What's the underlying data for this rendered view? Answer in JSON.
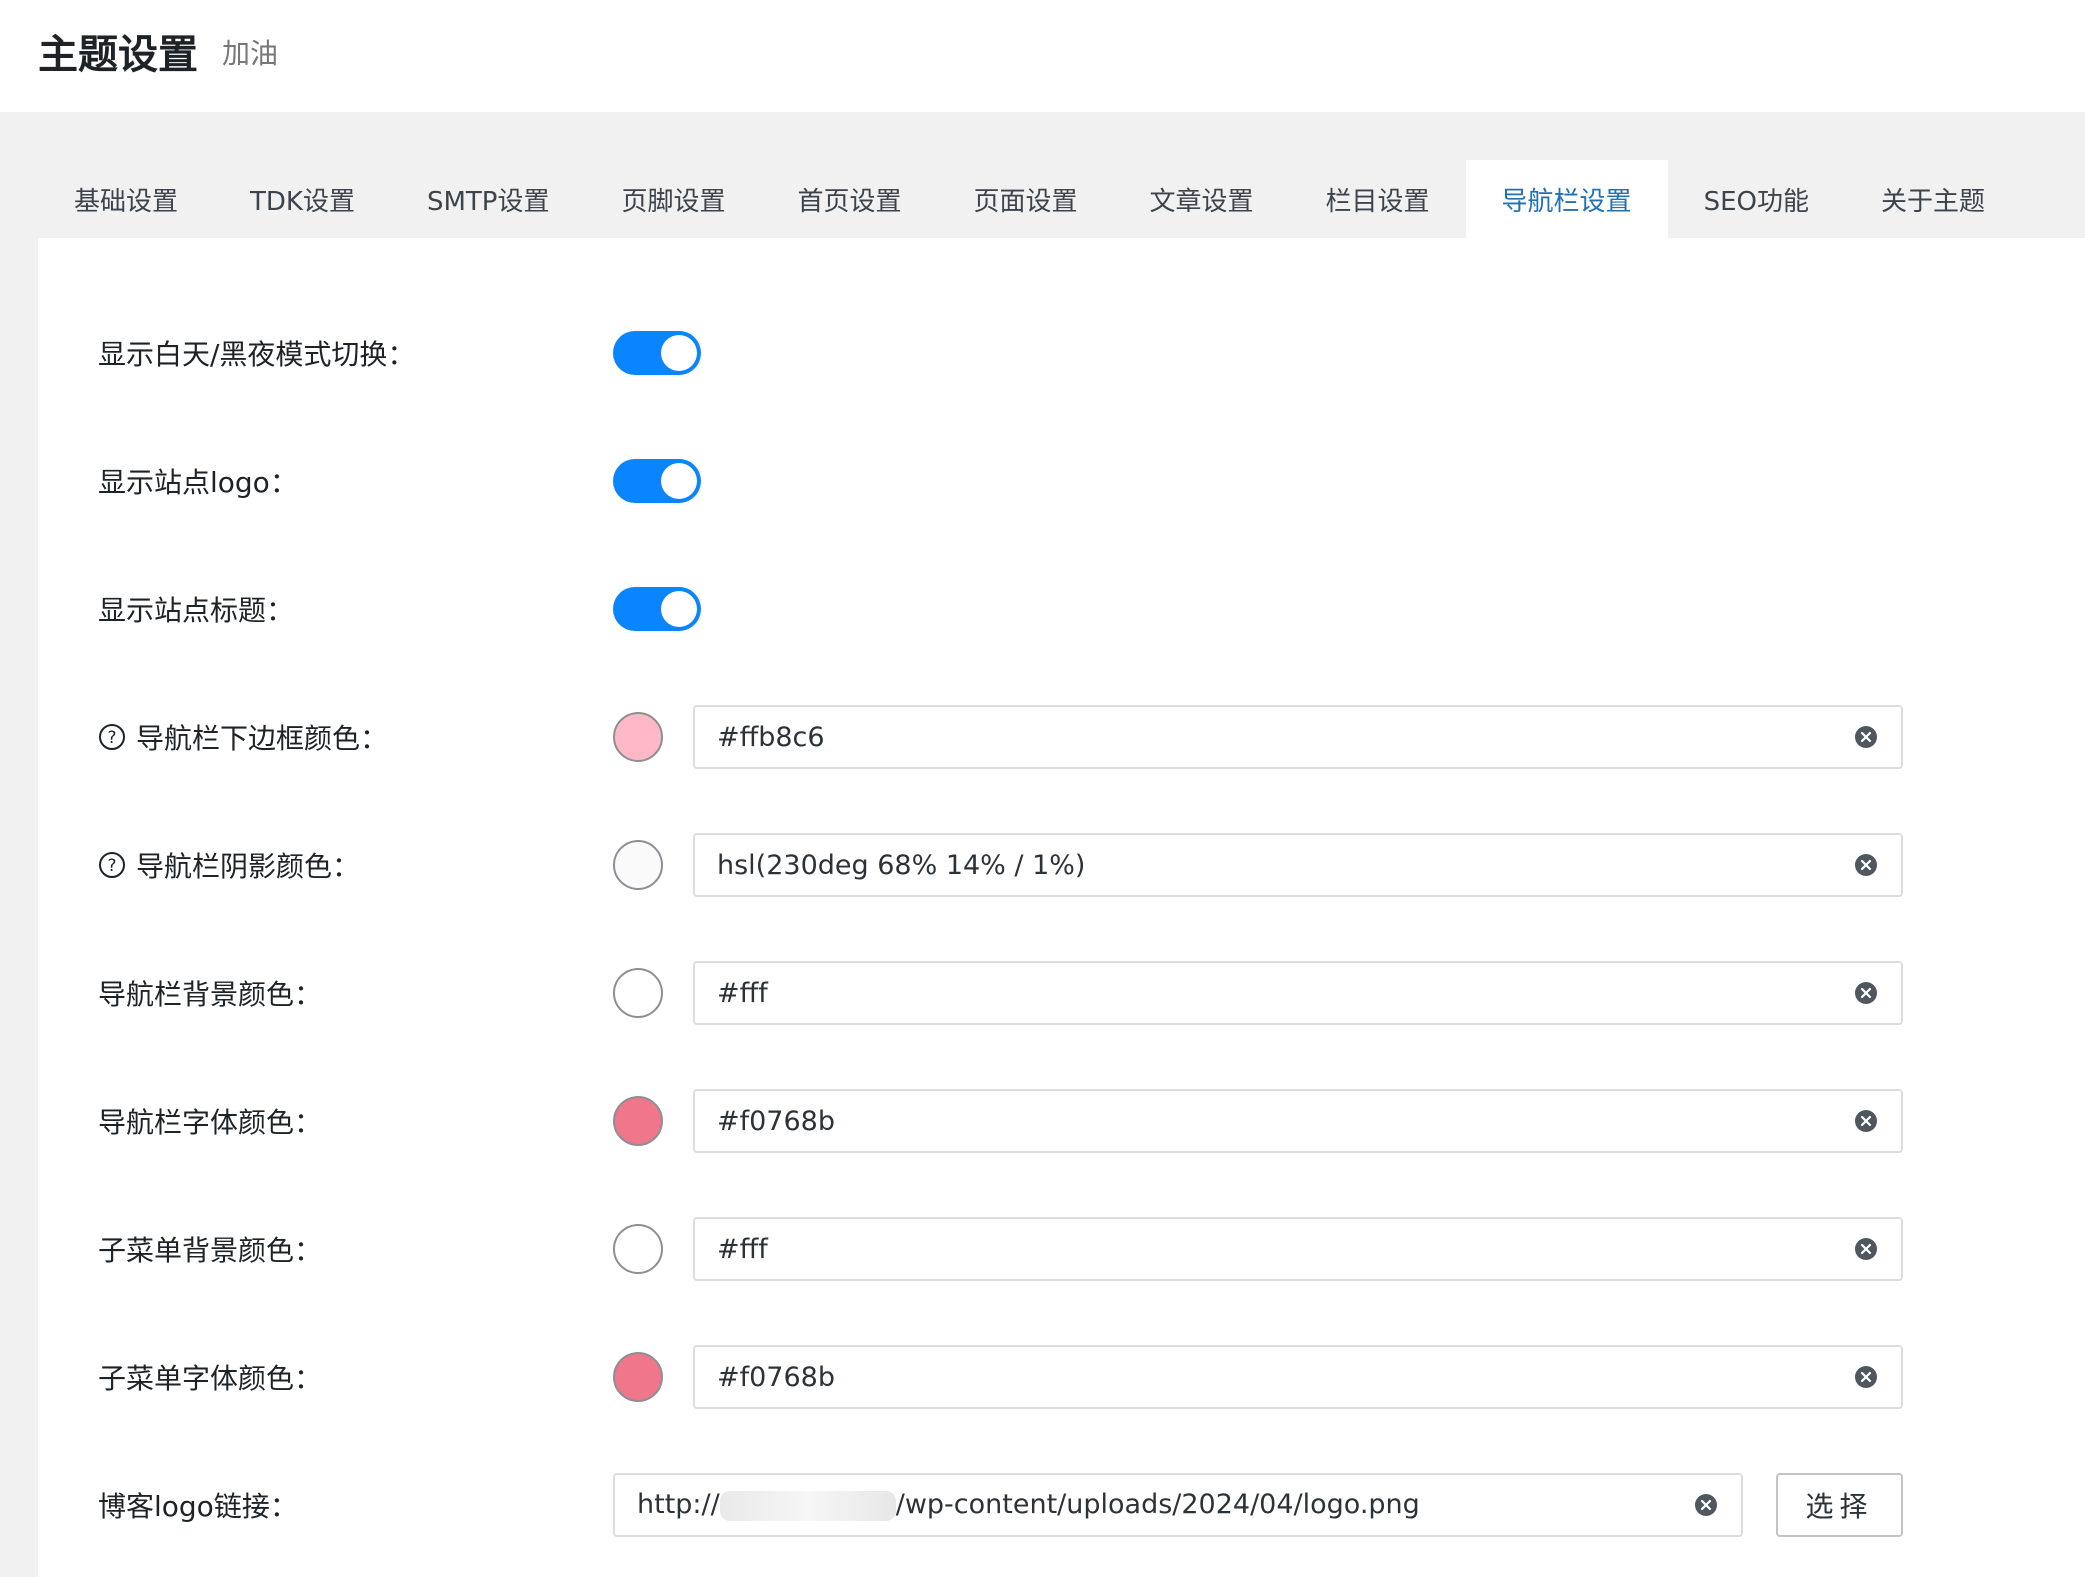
{
  "page": {
    "title": "主题设置",
    "subtitle": "加油"
  },
  "tabs": [
    {
      "label": "基础设置"
    },
    {
      "label": "TDK设置"
    },
    {
      "label": "SMTP设置"
    },
    {
      "label": "页脚设置"
    },
    {
      "label": "首页设置"
    },
    {
      "label": "页面设置"
    },
    {
      "label": "文章设置"
    },
    {
      "label": "栏目设置"
    },
    {
      "label": "导航栏设置",
      "active": true
    },
    {
      "label": "SEO功能"
    },
    {
      "label": "关于主题"
    }
  ],
  "settings": {
    "toggle_day_night": {
      "label": "显示白天/黑夜模式切换：",
      "on": true
    },
    "toggle_logo": {
      "label": "显示站点logo：",
      "on": true
    },
    "toggle_title": {
      "label": "显示站点标题：",
      "on": true
    },
    "border_color": {
      "label": "导航栏下边框颜色：",
      "value": "#ffb8c6",
      "swatch": "#ffb8c6"
    },
    "shadow_color": {
      "label": "导航栏阴影颜色：",
      "value": "hsl(230deg 68% 14% / 1%)",
      "swatch": "#fafafb"
    },
    "bg_color": {
      "label": "导航栏背景颜色：",
      "value": "#fff",
      "swatch": "#ffffff"
    },
    "font_color": {
      "label": "导航栏字体颜色：",
      "value": "#f0768b",
      "swatch": "#f0768b"
    },
    "submenu_bg_color": {
      "label": "子菜单背景颜色：",
      "value": "#fff",
      "swatch": "#ffffff"
    },
    "submenu_font_color": {
      "label": "子菜单字体颜色：",
      "value": "#f0768b",
      "swatch": "#f0768b"
    },
    "logo_url": {
      "label": "博客logo链接：",
      "value_prefix": "http://",
      "value_suffix": "/wp-content/uploads/2024/04/logo.png",
      "button": "选择"
    }
  },
  "icons": {
    "help": "help-circle-icon",
    "clear": "clear-circle-icon"
  },
  "colors": {
    "accent": "#2271b1",
    "toggle_on": "#0a84ff"
  }
}
